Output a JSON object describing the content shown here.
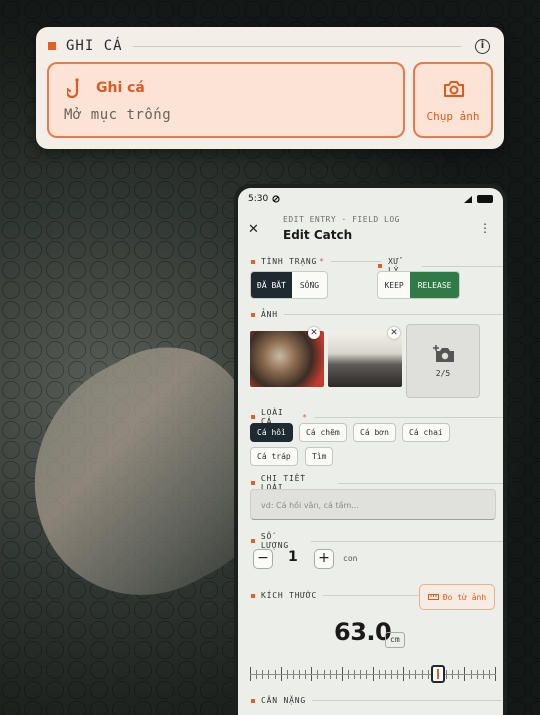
{
  "top_card": {
    "header": "GHI CÁ",
    "main_title": "Ghi cá",
    "main_subtitle": "Mở mục trống",
    "camera_label": "Chụp ảnh"
  },
  "status": {
    "time": "5:30"
  },
  "header": {
    "overline": "EDIT ENTRY · FIELD LOG",
    "title": "Edit Catch"
  },
  "status_section": {
    "label": "TÌNH TRẠNG",
    "options": [
      "ĐÃ BẮT",
      "SỐNG"
    ],
    "selected": "ĐÃ BẮT"
  },
  "handling_section": {
    "label": "XỬ LÝ",
    "options": [
      "KEEP",
      "RELEASE"
    ],
    "selected": "RELEASE"
  },
  "photo_section": {
    "label": "ẢNH",
    "count": "2/5"
  },
  "species_section": {
    "label": "LOÀI CÁ",
    "chips": [
      "Cá hồi",
      "Cá chẽm",
      "Cá bơn",
      "Cá chai",
      "Cá tráp",
      "Tìm"
    ],
    "selected": "Cá hồi"
  },
  "species_detail": {
    "label": "CHI TIẾT LOÀI",
    "placeholder": "vd: Cá hồi vân, cá tầm..."
  },
  "quantity": {
    "label": "SỐ LƯỢNG",
    "minus": "−",
    "plus": "+",
    "value": "1",
    "unit": "con"
  },
  "size": {
    "label": "KÍCH THƯỚC",
    "measure_button": "Đo từ ảnh",
    "value": "63.0",
    "unit": "cm",
    "slider_fraction": 0.78
  },
  "weight": {
    "label": "CÂN NẶNG"
  },
  "colors": {
    "accent": "#e0602a",
    "dark": "#1f2a30",
    "release_green": "#2f7a45"
  }
}
